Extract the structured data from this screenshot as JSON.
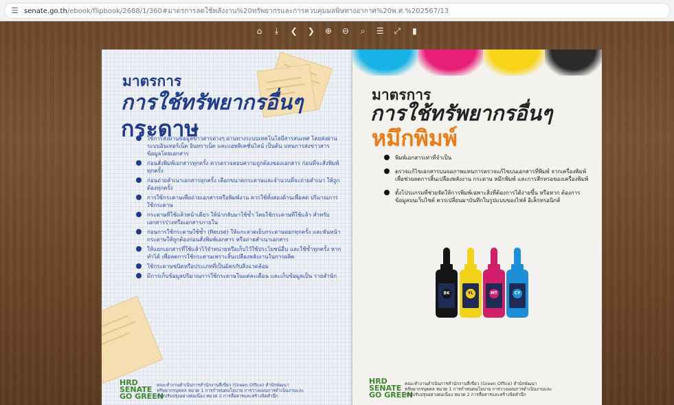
{
  "browser": {
    "url_host": "senate.go.th",
    "url_path": "/ebook/flipbook/2688/1/360#มาตรการลดใช้พลังงาน%20ทรัพยากรและการควบคุมมลพิษทางอากาศ%20พ.ศ.%202567/13"
  },
  "toolbar": {
    "home": "⌂",
    "download": "⤓",
    "prev": "❮",
    "next": "❯",
    "zoom_in": "⊕",
    "zoom_out": "⊖",
    "search": "⌕",
    "toc": "☰",
    "fullscreen": "⤢",
    "page_view": "▮"
  },
  "left_page": {
    "title_small": "มาตรการ",
    "title_big": "การใช้ทรัพยากรอื่นๆ",
    "title_topic": "กระดาษ",
    "items": [
      "ใช้การส่งผ่านข้อมูลข่าวสารต่างๆ ผ่านทางระบบเทคโนโลยีสารสนเทศ โดยส่งผ่านระบบอินเทอร์เน็ต อินทราเน็ต และแอพลิเคชั่นไลน์ เป็นต้น แทนการส่งข่าวสารข้อมูลโดยเอกสาร",
      "ก่อนสั่งพิมพ์เอกสารทุกครั้ง ควรตรวจสอบความถูกต้องของเอกสาร ก่อนที่จะสั่งพิมพ์ทุกครั้ง",
      "ก่อนถ่ายสำเนาเอกสารทุกครั้ง เลือกขนาดกระดาษและจำนวนที่จะถ่ายสำเนา ให้ถูกต้องทุกครั้ง",
      "การใช้กระดาษเพื่อถ่ายเอกสารหรือพิมพ์งาน ควรใช้ทั้งสองด้านเพื่อลด ปริมาณการใช้กระดาษ",
      "กระดาษที่ใช้แล้วหน้าเดียว ให้นำกลับมาใช้ซ้ำ โดยใช้กระดาษที่ใช้แล้ว สำหรับเอกสารร่างหรือเอกสารภายใน",
      "ก่อนการใช้กระดาษใช้ซ้ำ (Reuse) ให้แกะลวดเย็บกระดาษออกทุกครั้ง และหันหน้ากระดาษให้ถูกต้องก่อนสั่งพิมพ์เอกสาร หรือถ่ายสำเนาเอกสาร",
      "ให้แยกเอกสารที่ใช้แล้วไว้จำหน่ายหรือเก็บไว้ใช้ประโยชน์อื่น และใช้ซ้ำทุกครั้ง หากทำได้ เพื่อลดการใช้กระดาษเพราะสิ้นเปลืองพลังงานในการผลิต",
      "ใช้กระดาษชนิดหรือประเภทที่เป็นมิตรกับสิ่งแวดล้อม",
      "มีการเก็บข้อมูลปริมาณการใช้กระดาษในแต่ละเดือน และเก็บข้อมูลเป็น รายสำนัก"
    ],
    "footer_logo": [
      "HRD",
      "SENATE",
      "GO GREEN"
    ],
    "footer_text": "คณะทำงานดำเนินการสำนักงานสีเขียว (Green Office) สำนักพัฒนาทรัพยากรบุคคล หมวด 1 การกำหนดนโยบาย การวางแผนการดำเนินงานและการปรับปรุงอย่างต่อเนื่อง หมวด 2 การสื่อสารและสร้างจิตสำนึก"
  },
  "right_page": {
    "title_small": "มาตรการ",
    "title_big": "การใช้ทรัพยากรอื่นๆ",
    "title_topic": "หมึกพิมพ์",
    "items": [
      "พิมพ์เอกสารเท่าที่จำเป็น",
      "ตรวจแก้ไขเอกสารบนจอภาพแทนการตรวจแก้ไขบนเอกสารที่พิมพ์ จากเครื่องพิมพ์ เพื่อช่วยลดการสิ้นเปลืองพลังงาน กระดาษ หมึกพิมพ์ และการสึกหรอของเครื่องพิมพ์",
      "ตั้งโปรแกรมที่ช่วยจัดให้การพิมพ์เฉพาะสิ่งที่ต้องการได้ง่ายขึ้น หรือหาก ต้องการข้อมูลบนเว็บไซต์ ควรเปลี่ยนมาบันทึกในรูปแบบของไฟล์ อิเล็กทรอนิกส์"
    ],
    "bottles": [
      {
        "code": "BK",
        "color": "#151515"
      },
      {
        "code": "YL",
        "color": "#f3d21a"
      },
      {
        "code": "MT",
        "color": "#d11f6a"
      },
      {
        "code": "CY",
        "color": "#1c8fd8"
      }
    ],
    "splash_colors": [
      "#18b3e6",
      "#e81f78",
      "#f7d418",
      "#2b2b2b"
    ],
    "footer_logo": [
      "HRD",
      "SENATE",
      "GO GREEN"
    ],
    "footer_text": "คณะทำงานดำเนินการสำนักงานสีเขียว (Green Office) สำนักพัฒนาทรัพยากรบุคคล หมวด 1 การกำหนดนโยบาย การวางแผนการดำเนินงานและการปรับปรุงอย่างต่อเนื่อง หมวด 2 การสื่อสารและสร้างจิตสำนึก"
  },
  "colors": {
    "title_blue": "#1f3c8c",
    "topic_orange": "#f07a12",
    "logo_green": "#3b8a2a"
  }
}
